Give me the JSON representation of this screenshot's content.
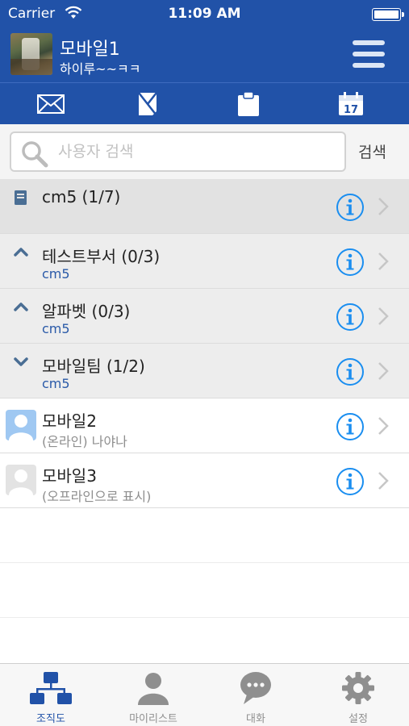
{
  "status_bar": {
    "carrier": "Carrier",
    "time": "11:09 AM"
  },
  "header": {
    "name": "모바일1",
    "status_message": "하이루~~ㅋㅋ"
  },
  "toolbar": {
    "icons": [
      "mail-icon",
      "note-icon",
      "clipboard-icon",
      "calendar-icon"
    ],
    "calendar_day": "17"
  },
  "search": {
    "placeholder": "사용자 검색",
    "value": "",
    "button_label": "검색"
  },
  "list": {
    "root": {
      "title": "cm5 (1/7)"
    },
    "departments": [
      {
        "title": "테스트부서 (0/3)",
        "parent": "cm5",
        "state": "collapsed"
      },
      {
        "title": "알파벳 (0/3)",
        "parent": "cm5",
        "state": "collapsed"
      },
      {
        "title": "모바일팀 (1/2)",
        "parent": "cm5",
        "state": "expanded"
      }
    ],
    "users": [
      {
        "name": "모바일2",
        "status": "(온라인) 나야나",
        "online": true
      },
      {
        "name": "모바일3",
        "status": "(오프라인으로 표시)",
        "online": false
      }
    ]
  },
  "tabbar": {
    "tabs": [
      {
        "label": "조직도",
        "icon": "org-chart-icon",
        "active": true
      },
      {
        "label": "마이리스트",
        "icon": "person-icon",
        "active": false
      },
      {
        "label": "대화",
        "icon": "chat-bubble-icon",
        "active": false
      },
      {
        "label": "설정",
        "icon": "gear-icon",
        "active": false
      }
    ]
  },
  "colors": {
    "brand_blue": "#2152a8",
    "info_blue": "#1a8ef0",
    "online_avatar": "#9fc8f2",
    "offline_avatar": "#e3e3e3"
  }
}
